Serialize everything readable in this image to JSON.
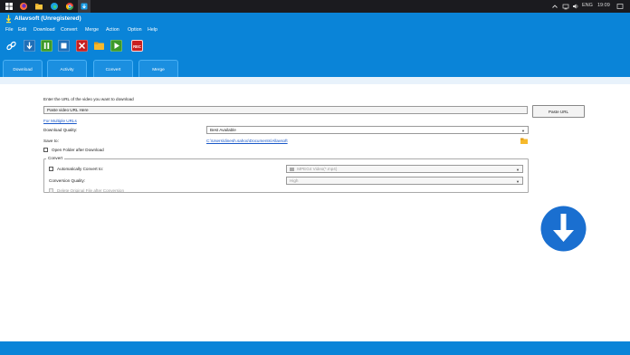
{
  "taskbar": {
    "language": "ENG",
    "time": "19:09"
  },
  "window": {
    "title": "Allavsoft (Unregistered)"
  },
  "menu": [
    "File",
    "Edit",
    "Download",
    "Convert",
    "Merge",
    "Action",
    "Option",
    "Help"
  ],
  "toolbar": {
    "buttons": [
      "link-icon",
      "download-icon",
      "pause-icon",
      "stop-icon",
      "delete-icon",
      "folder-icon",
      "play-icon",
      "record-icon"
    ],
    "rec_label": "REC"
  },
  "tabs": [
    "Download",
    "Activity",
    "Convert",
    "Merge"
  ],
  "form": {
    "url_prompt": "Enter the URL of the video you want to download",
    "url_placeholder": "Paste video URL Here",
    "paste_button": "Paste URL",
    "multiple_urls_link": "For Multiple URLs",
    "quality_label": "Download Quality:",
    "quality_value": "Best Available",
    "save_to_label": "Save to:",
    "save_to_path": "C:\\Users\\dinesh.sahoo\\Documents\\Allavsoft",
    "open_folder_label": "Open Folder after Download",
    "convert_group_label": "Convert",
    "auto_convert_label": "Automatically Convert to:",
    "auto_convert_value": "MPEG4 Video(*.mp4)",
    "conv_quality_label": "Conversion Quality:",
    "conv_quality_value": "High",
    "delete_original_label": "Delete Original File after Conversion"
  },
  "colors": {
    "accent": "#0a84d8",
    "download_button": "#1a6fd0"
  }
}
